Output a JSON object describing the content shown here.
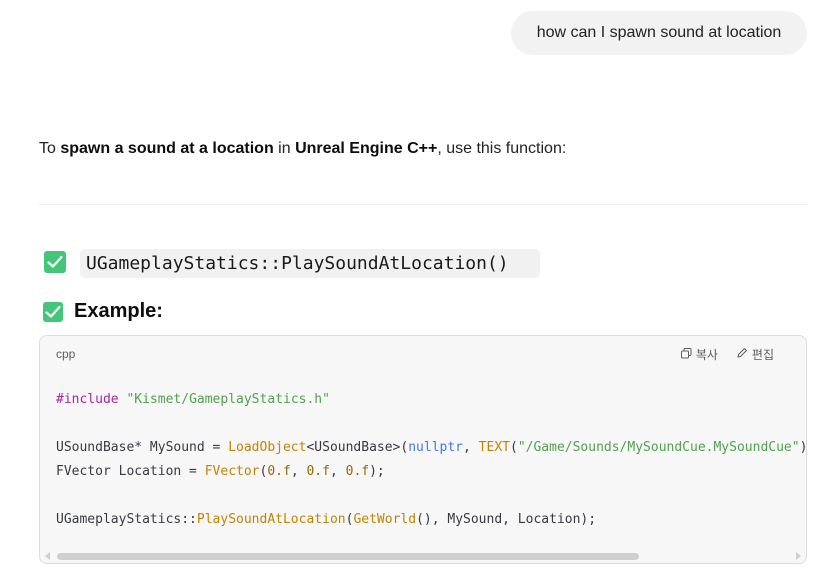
{
  "user_message": "how can I spawn sound at location",
  "intro": {
    "p1": "To ",
    "b1": "spawn a sound at a location",
    "p2": " in ",
    "b2": "Unreal Engine C++",
    "p3": ", use this function:"
  },
  "function_name": "UGameplayStatics::PlaySoundAtLocation()",
  "example_heading": "Example:",
  "code_block": {
    "language": "cpp",
    "copy_label": "복사",
    "edit_label": "편집",
    "copy_icon": "copy-icon",
    "edit_icon": "pencil-icon",
    "lines": [
      [
        {
          "t": "#include",
          "c": "kw"
        },
        {
          "t": " ",
          "c": "pl"
        },
        {
          "t": "\"Kismet/GameplayStatics.h\"",
          "c": "str"
        }
      ],
      [],
      [
        {
          "t": "USoundBase* MySound = ",
          "c": "pl"
        },
        {
          "t": "LoadObject",
          "c": "fn"
        },
        {
          "t": "<USoundBase>(",
          "c": "pl"
        },
        {
          "t": "nullptr",
          "c": "kw2"
        },
        {
          "t": ", ",
          "c": "pl"
        },
        {
          "t": "TEXT",
          "c": "fn"
        },
        {
          "t": "(",
          "c": "pl"
        },
        {
          "t": "\"/Game/Sounds/MySoundCue.MySoundCue\"",
          "c": "str"
        },
        {
          "t": "));",
          "c": "pl"
        }
      ],
      [
        {
          "t": "FVector Location = ",
          "c": "pl"
        },
        {
          "t": "FVector",
          "c": "fn"
        },
        {
          "t": "(",
          "c": "pl"
        },
        {
          "t": "0.f",
          "c": "num"
        },
        {
          "t": ", ",
          "c": "pl"
        },
        {
          "t": "0.f",
          "c": "num"
        },
        {
          "t": ", ",
          "c": "pl"
        },
        {
          "t": "0.f",
          "c": "num"
        },
        {
          "t": ");",
          "c": "pl"
        }
      ],
      [],
      [
        {
          "t": "UGameplayStatics::",
          "c": "pl"
        },
        {
          "t": "PlaySoundAtLocation",
          "c": "fn"
        },
        {
          "t": "(",
          "c": "pl"
        },
        {
          "t": "GetWorld",
          "c": "fn"
        },
        {
          "t": "(), MySound, Location);",
          "c": "pl"
        }
      ]
    ]
  },
  "colors": {
    "check_green": "#43c67a",
    "bubble_bg": "#f2f2f2",
    "code_bg": "#f7f7f7"
  }
}
